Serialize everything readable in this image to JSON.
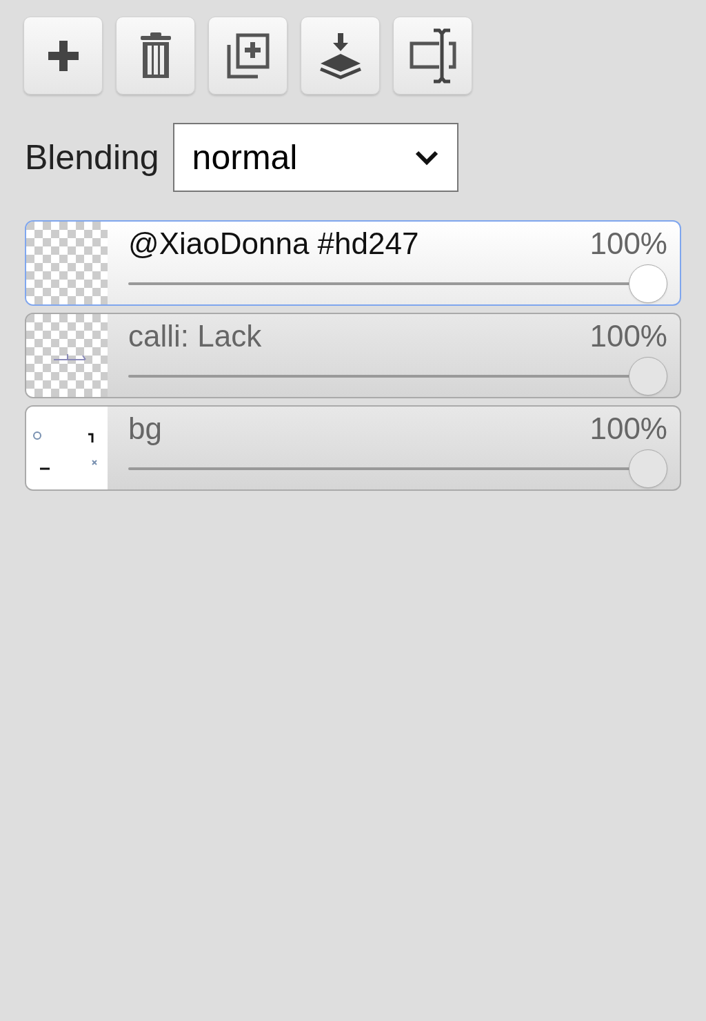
{
  "toolbar": [
    {
      "kind": "add"
    },
    {
      "kind": "delete"
    },
    {
      "kind": "duplicate"
    },
    {
      "kind": "merge"
    },
    {
      "kind": "rename"
    }
  ],
  "blending": {
    "label": "Blending",
    "value": "normal"
  },
  "layers": [
    {
      "name": "@XiaoDonna #hd247",
      "opacity": "100%",
      "level": 1,
      "selected": true,
      "kind": "transparent"
    },
    {
      "name": "calli: Lack",
      "opacity": "100%",
      "level": 1,
      "selected": false,
      "kind": "transparent"
    },
    {
      "name": "bg",
      "opacity": "100%",
      "level": 1,
      "selected": false,
      "kind": "white"
    }
  ]
}
